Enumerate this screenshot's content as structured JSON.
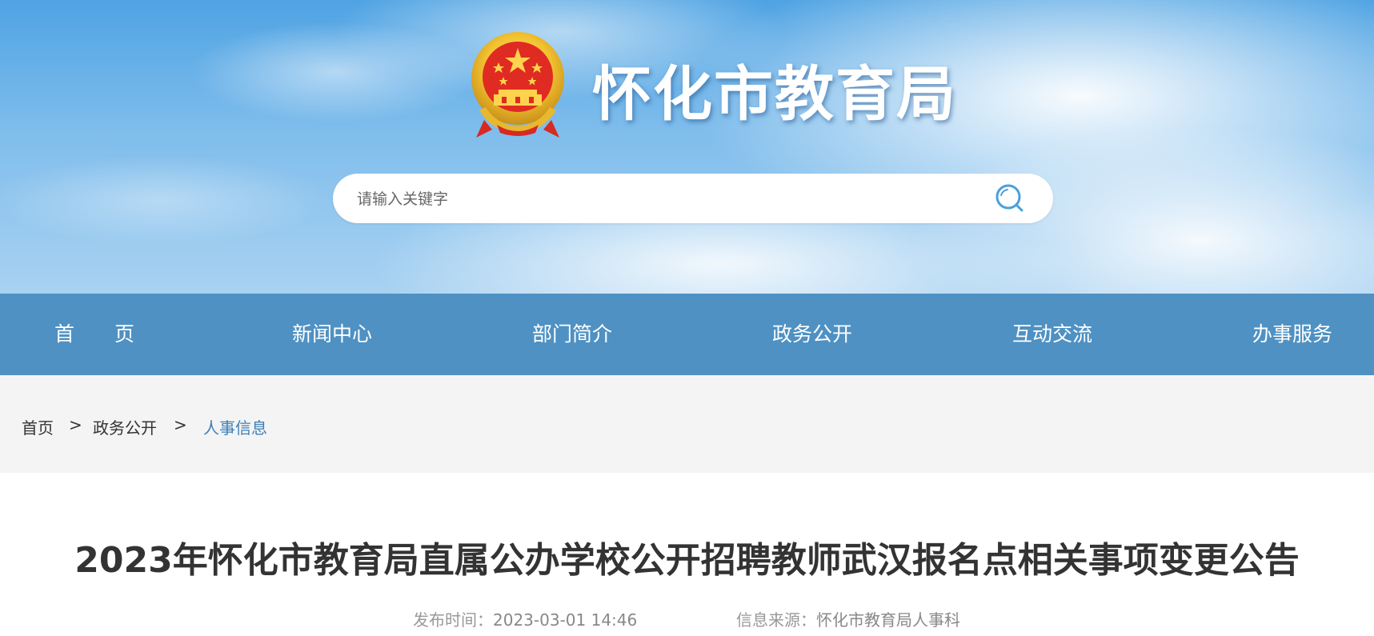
{
  "header": {
    "site_title": "怀化市教育局",
    "emblem_icon": "national-emblem-icon"
  },
  "search": {
    "placeholder": "请输入关键字",
    "value": "",
    "icon": "search-icon"
  },
  "nav": {
    "items": [
      {
        "label": "首　　页"
      },
      {
        "label": "新闻中心"
      },
      {
        "label": "部门简介"
      },
      {
        "label": "政务公开"
      },
      {
        "label": "互动交流"
      },
      {
        "label": "办事服务"
      }
    ]
  },
  "breadcrumb": {
    "items": [
      {
        "label": "首页"
      },
      {
        "label": "政务公开"
      },
      {
        "label": "人事信息"
      }
    ],
    "separator": ">"
  },
  "article": {
    "title": "2023年怀化市教育局直属公办学校公开招聘教师武汉报名点相关事项变更公告",
    "publish_label": "发布时间：",
    "publish_time": "2023-03-01 14:46",
    "source_label": "信息来源：",
    "source": "怀化市教育局人事科"
  },
  "colors": {
    "nav_bg": "#4f91c3",
    "breadcrumb_active": "#3d7fb8",
    "breadcrumb_bg": "#f4f4f4",
    "title_text": "#333333",
    "meta_text": "#999999"
  }
}
